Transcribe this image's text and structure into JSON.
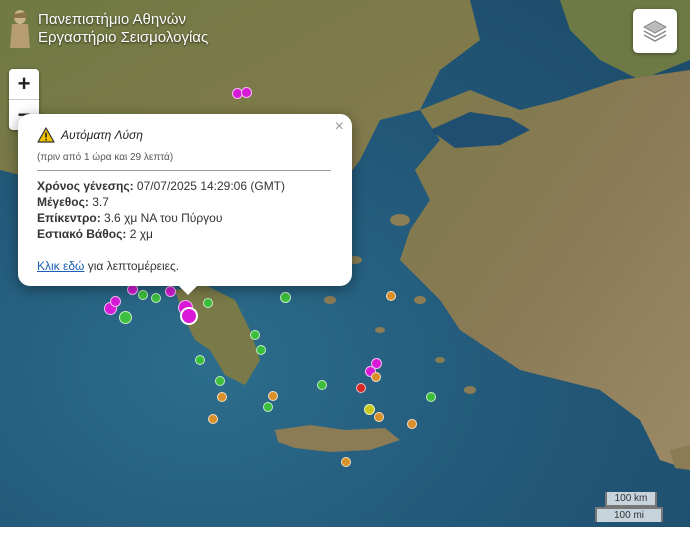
{
  "header": {
    "title_line1": "Πανεπιστήμιο Αθηνών",
    "title_line2": "Εργαστήριο Σεισμολογίας"
  },
  "zoom": {
    "in_label": "+",
    "out_label": "−"
  },
  "popup": {
    "title": "Αυτόματη Λύση",
    "ago": "(πριν από 1 ώρα και 29 λεπτά)",
    "origin_time_label": "Χρόνος γένεσης:",
    "origin_time_value": "07/07/2025 14:29:06 (GMT)",
    "magnitude_label": "Μέγεθος:",
    "magnitude_value": "3.7",
    "epicenter_label": "Επίκεντρο:",
    "epicenter_value": "3.6 χμ ΝΑ του Πύργου",
    "depth_label": "Εστιακό Βάθος:",
    "depth_value": "2 χμ",
    "link_text": "Κλικ εδώ",
    "link_suffix": "για λεπτομέρειες.",
    "close": "×"
  },
  "scale": {
    "km": "100 km",
    "mi": "100 mi"
  },
  "colors": {
    "magenta": "#d81ad8",
    "green": "#3cbf3c",
    "orange": "#d9902a",
    "yellow": "#c8c81e",
    "red": "#d62a2a"
  },
  "icons": {
    "layers": "layers-icon",
    "warning": "warning-icon"
  }
}
